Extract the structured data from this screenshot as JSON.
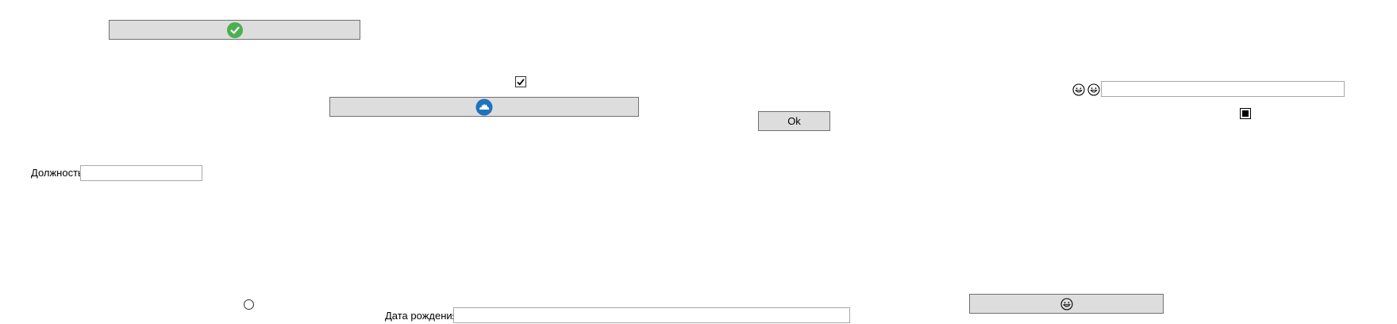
{
  "labels": {
    "position": "Должность",
    "birth_date": "Дата рождения"
  },
  "buttons": {
    "ok": "Ok"
  },
  "fields": {
    "position_value": "",
    "birth_date_value": "",
    "emoji_field_value": ""
  },
  "checkbox": {
    "checked": true
  },
  "colors": {
    "button_bg": "#dddddd",
    "success_green": "#4caf50",
    "cloud_blue": "#1e73be"
  },
  "icons": {
    "top_button": "check-circle-icon",
    "cloud_button": "cloud-icon",
    "emoji_a": "grinning-face-icon",
    "emoji_b": "smiling-face-icon",
    "bottom_button": "grinning-face-icon"
  }
}
